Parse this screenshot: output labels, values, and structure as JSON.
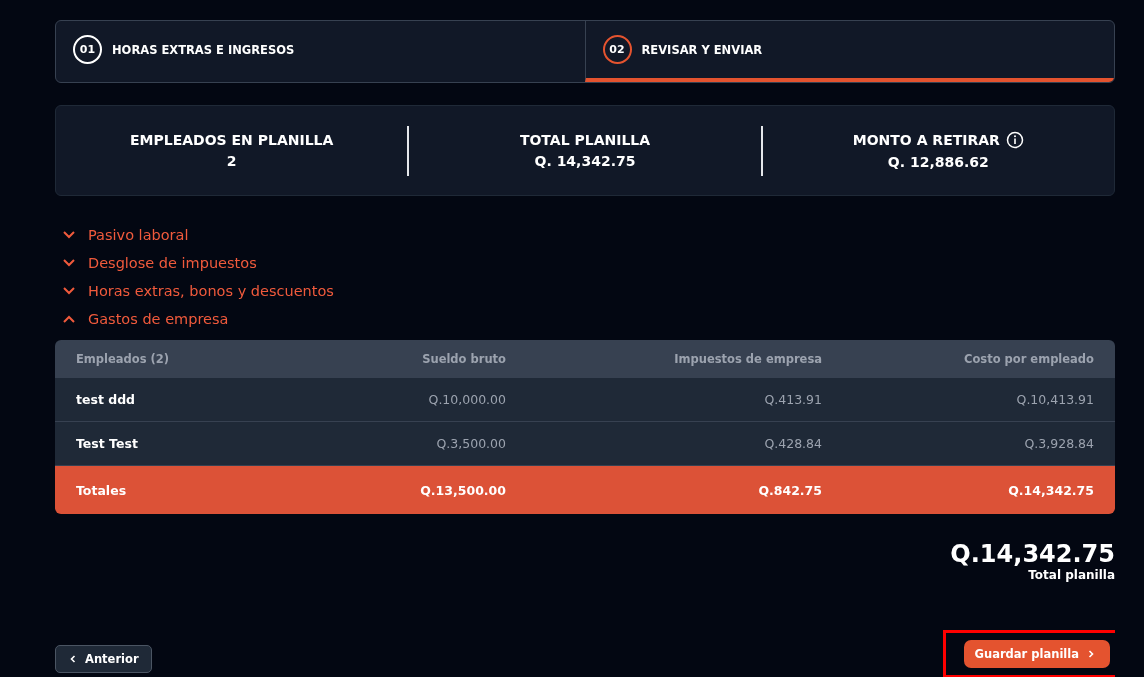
{
  "steps": [
    {
      "number": "01",
      "label": "HORAS EXTRAS E INGRESOS",
      "selected": false
    },
    {
      "number": "02",
      "label": "REVISAR Y ENVIAR",
      "selected": true
    }
  ],
  "summary": [
    {
      "label": "EMPLEADOS EN PLANILLA",
      "value": "2",
      "info": false
    },
    {
      "label": "TOTAL PLANILLA",
      "value": "Q. 14,342.75",
      "info": false
    },
    {
      "label": "MONTO A RETIRAR",
      "value": "Q. 12,886.62",
      "info": true
    }
  ],
  "sections": [
    {
      "label": "Pasivo laboral",
      "expanded": false
    },
    {
      "label": "Desglose de impuestos",
      "expanded": false
    },
    {
      "label": "Horas extras, bonos y descuentos",
      "expanded": false
    },
    {
      "label": "Gastos de empresa",
      "expanded": true
    }
  ],
  "table": {
    "columns": [
      "Empleados (2)",
      "Sueldo bruto",
      "Impuestos de empresa",
      "Costo por empleado"
    ],
    "rows": [
      [
        "test ddd",
        "Q.10,000.00",
        "Q.413.91",
        "Q.10,413.91"
      ],
      [
        "Test Test",
        "Q.3,500.00",
        "Q.428.84",
        "Q.3,928.84"
      ]
    ],
    "totals": [
      "Totales",
      "Q.13,500.00",
      "Q.842.75",
      "Q.14,342.75"
    ]
  },
  "grand_total": {
    "value": "Q.14,342.75",
    "label": "Total planilla"
  },
  "buttons": {
    "back": "Anterior",
    "next": "Guardar planilla"
  }
}
